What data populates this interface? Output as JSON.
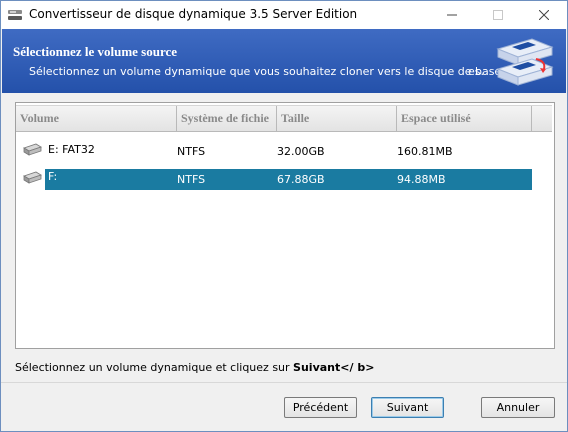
{
  "window": {
    "title": "Convertisseur de disque dynamique 3.5 Server Edition"
  },
  "banner": {
    "title": "Sélectionnez le volume source",
    "subtitle": "Sélectionnez un volume dynamique que vous souhaitez cloner vers le disque de base.",
    "subtitle_tail": "es."
  },
  "list": {
    "columns": [
      "Volume",
      "Système de fichie",
      "Taille",
      "Espace utilisé"
    ],
    "rows": [
      {
        "volume": "E: FAT32",
        "fs": "NTFS",
        "size": "32.00GB",
        "used": "160.81MB",
        "selected": false
      },
      {
        "volume": "F:",
        "fs": "NTFS",
        "size": "67.88GB",
        "used": "94.88MB",
        "selected": true
      }
    ]
  },
  "status": {
    "prefix": "Sélectionnez un volume dynamique et cliquez sur ",
    "bold": "Suivant</ b>"
  },
  "buttons": {
    "prev": "Précédent",
    "next": "Suivant",
    "cancel": "Annuler"
  },
  "colors": {
    "banner": "#2f5cb6",
    "selection": "#1a7ba1"
  },
  "icons": [
    "app-icon",
    "minimize-icon",
    "maximize-icon",
    "close-icon",
    "drive-icon",
    "disk-clone-illustration"
  ]
}
